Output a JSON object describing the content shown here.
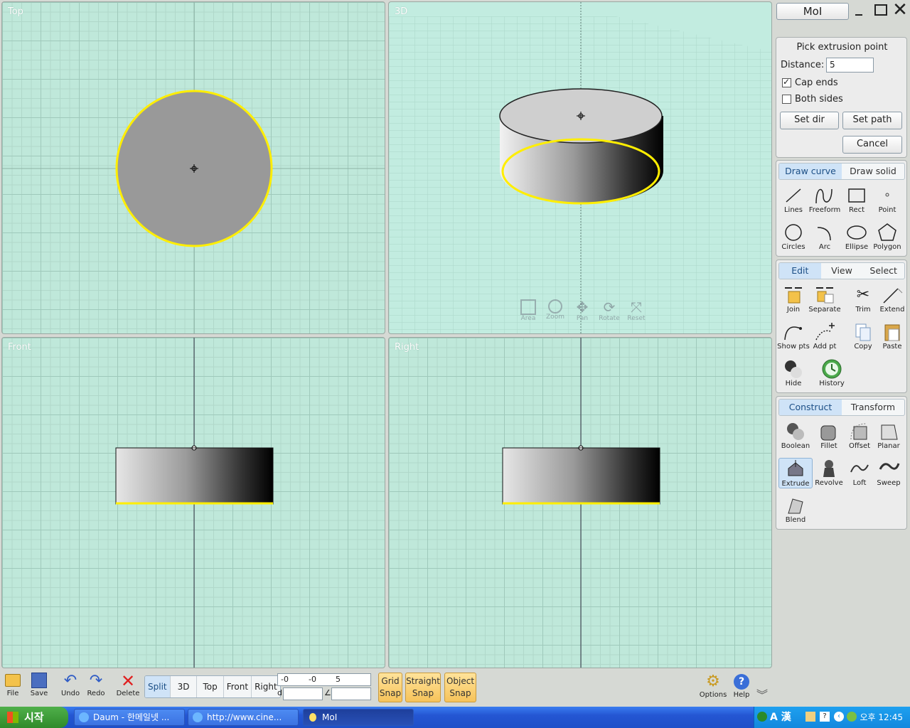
{
  "viewports": {
    "top": "Top",
    "three_d": "3D",
    "front": "Front",
    "right": "Right",
    "nav": [
      "Area",
      "Zoom",
      "Pan",
      "Rotate",
      "Reset"
    ]
  },
  "window": {
    "title": "MoI"
  },
  "extrude": {
    "prompt": "Pick extrusion point",
    "distance_label": "Distance:",
    "distance_value": "5",
    "cap_ends": "Cap ends",
    "cap_ends_checked": true,
    "both_sides": "Both sides",
    "both_sides_checked": false,
    "set_dir": "Set dir",
    "set_path": "Set path",
    "cancel": "Cancel"
  },
  "draw": {
    "tabs": [
      "Draw curve",
      "Draw solid"
    ],
    "tools": [
      "Lines",
      "Freeform",
      "Rect",
      "Point",
      "Circles",
      "Arc",
      "Ellipse",
      "Polygon"
    ]
  },
  "edit": {
    "tabs": [
      "Edit",
      "View",
      "Select"
    ],
    "tools": [
      "Join",
      "Separate",
      "Trim",
      "Extend",
      "Show pts",
      "Add pt",
      "Copy",
      "Paste",
      "Hide",
      "History"
    ]
  },
  "construct": {
    "tabs": [
      "Construct",
      "Transform"
    ],
    "tools": [
      "Boolean",
      "Fillet",
      "Offset",
      "Planar",
      "Extrude",
      "Revolve",
      "Loft",
      "Sweep",
      "Blend"
    ]
  },
  "bottom": {
    "file": "File",
    "save": "Save",
    "undo": "Undo",
    "redo": "Redo",
    "delete": "Delete",
    "views": [
      "Split",
      "3D",
      "Top",
      "Front",
      "Right"
    ],
    "coord_x": "-0",
    "coord_y": "-0",
    "coord_z": "5",
    "d_label": "d",
    "angle_label": "∠",
    "grid_snap": [
      "Grid",
      "Snap"
    ],
    "straight_snap": [
      "Straight",
      "Snap"
    ],
    "object_snap": [
      "Object",
      "Snap"
    ],
    "options": "Options",
    "help": "Help"
  },
  "taskbar": {
    "start": "시작",
    "tasks": [
      "Daum - 한메일넷 ...",
      "http://www.cine...",
      "MoI"
    ],
    "clock": "오후 12:45",
    "ime": "A 漢"
  },
  "colors": {
    "viewport_bg": "#bfe8da",
    "selection": "#ffee00",
    "active_tab": "#cfe3f7"
  }
}
